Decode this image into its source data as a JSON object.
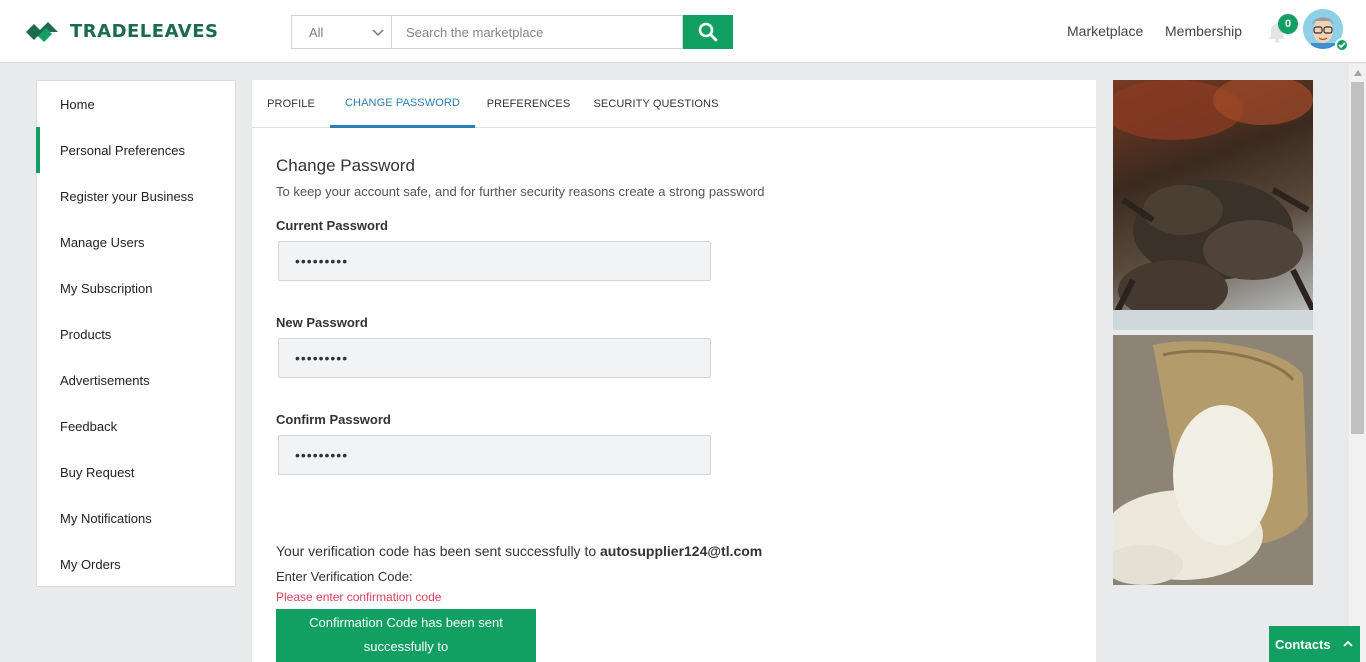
{
  "brand": {
    "name": "TRADELEAVES",
    "color": "#1b6b4c",
    "accent": "#11a061"
  },
  "search": {
    "category": "All",
    "placeholder": "Search the marketplace",
    "value": ""
  },
  "nav": {
    "marketplace": "Marketplace",
    "membership": "Membership",
    "notification_count": "0"
  },
  "sidebar": {
    "items": [
      {
        "label": "Home",
        "active": false
      },
      {
        "label": "Personal Preferences",
        "active": true
      },
      {
        "label": "Register your Business",
        "active": false
      },
      {
        "label": "Manage Users",
        "active": false
      },
      {
        "label": "My Subscription",
        "active": false
      },
      {
        "label": "Products",
        "active": false
      },
      {
        "label": "Advertisements",
        "active": false
      },
      {
        "label": "Feedback",
        "active": false
      },
      {
        "label": "Buy Request",
        "active": false
      },
      {
        "label": "My Notifications",
        "active": false
      },
      {
        "label": "My Orders",
        "active": false
      }
    ]
  },
  "tabs": [
    {
      "label": "PROFILE",
      "active": false
    },
    {
      "label": "CHANGE PASSWORD",
      "active": true
    },
    {
      "label": "PREFERENCES",
      "active": false
    },
    {
      "label": "SECURITY QUESTIONS",
      "active": false
    }
  ],
  "form": {
    "title": "Change Password",
    "subtitle": "To keep your account safe, and for further security reasons create a strong password",
    "current_label": "Current Password",
    "current_value": "•••••••••",
    "new_label": "New Password",
    "new_value": "•••••••••",
    "confirm_label": "Confirm Password",
    "confirm_value": "•••••••••"
  },
  "verification": {
    "message": "Your verification code has been sent successfully to",
    "email": "autosupplier124@tl.com",
    "enter_label": "Enter Verification Code:",
    "error": "Please enter confirmation code",
    "toast_line1": "Confirmation Code has been sent",
    "toast_line2": "successfully to"
  },
  "contacts": {
    "label": "Contacts"
  },
  "icons": {
    "logo": "leaf-logo-icon",
    "search": "search-icon",
    "bell": "bell-icon",
    "chevron": "chevron-down-icon",
    "check": "check-icon"
  }
}
